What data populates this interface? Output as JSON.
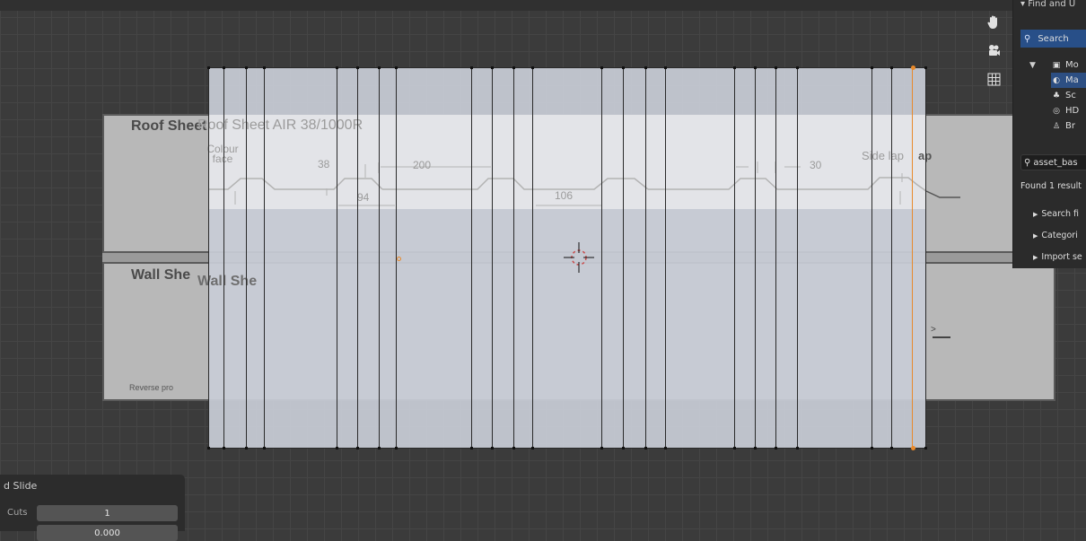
{
  "reference": {
    "roof_title": "Roof Sheet  AIR 38/1000R",
    "wall_title": "Wall She",
    "colour_face": "Colour face",
    "side_lap": "Side lap",
    "reverse_note": "Reverse pro",
    "dim_38": "38",
    "dim_200": "200",
    "dim_30": "30",
    "dim_94": "94",
    "dim_106": "106"
  },
  "side_panel": {
    "header": "Find and U",
    "search_label": "Search",
    "items": [
      "Mo",
      "Ma",
      "Sc",
      "HD",
      "Br"
    ],
    "search_value": "asset_bas",
    "results": "Found 1 result",
    "collapsed": [
      "Search fi",
      "Categori",
      "Import se"
    ]
  },
  "operator_panel": {
    "title": "d Slide",
    "cuts_label": "Cuts",
    "cuts_value": "1",
    "factor_value": "0.000"
  },
  "colors": {
    "selection": "#2d4f83",
    "active_edge": "#e8892a",
    "background": "#3b3b3b"
  },
  "icons": [
    "hand-icon",
    "camera-icon",
    "grid-icon",
    "search-icon",
    "mesh-icon",
    "material-icon",
    "scene-icon",
    "world-icon",
    "brush-icon"
  ]
}
